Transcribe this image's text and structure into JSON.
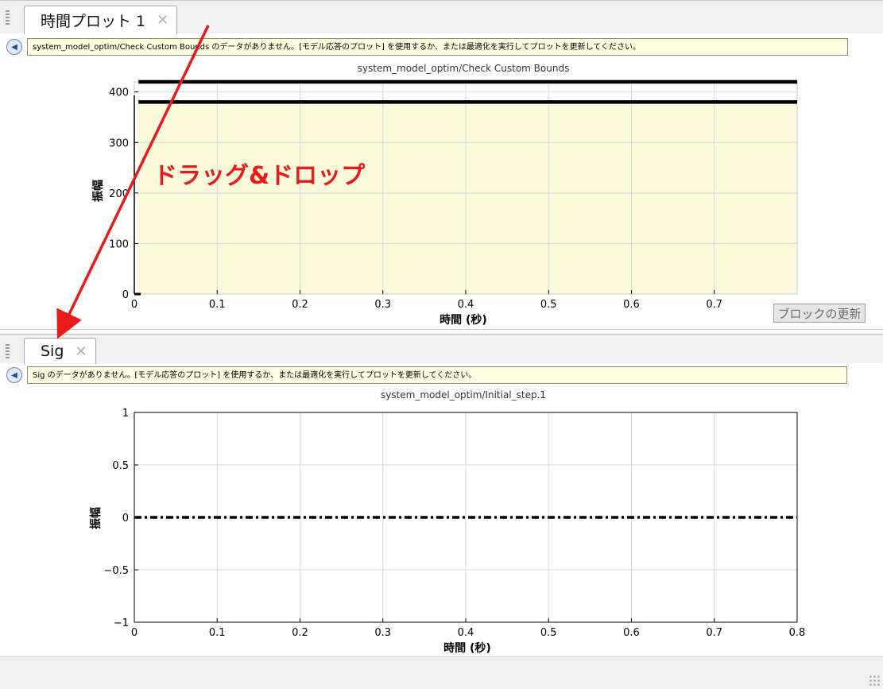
{
  "top_pane": {
    "tab": {
      "label": "時間プロット 1",
      "close": "✕"
    },
    "message": "system_model_optim/Check Custom Bounds のデータがありません。[モデル応答のプロット] を使用するか、または最適化を実行してプロットを更新してください。",
    "plot_title": "system_model_optim/Check Custom Bounds",
    "xlabel": "時間 (秒)",
    "ylabel": "振幅",
    "update_button": "ブロックの更新"
  },
  "bottom_pane": {
    "tab": {
      "label": "Sig",
      "close": "✕"
    },
    "message": "Sig のデータがありません。[モデル応答のプロット] を使用するか、または最適化を実行してプロットを更新してください。",
    "plot_title": "system_model_optim/Initial_step.1",
    "xlabel": "時間 (秒)",
    "ylabel": "振幅"
  },
  "annotation": {
    "text": "ドラッグ&ドロップ",
    "color": "#e81a1a"
  },
  "colors": {
    "bounds_fill": "#fbfbdb",
    "info_bg": "#ffffe1",
    "grid": "#d8d8d8"
  },
  "chart_data": [
    {
      "type": "line",
      "title": "system_model_optim/Check Custom Bounds",
      "xlabel": "時間 (秒)",
      "ylabel": "振幅",
      "xlim": [
        0,
        0.8
      ],
      "ylim": [
        0,
        420
      ],
      "x_ticks": [
        "0",
        "0.1",
        "0.2",
        "0.3",
        "0.4",
        "0.5",
        "0.6",
        "0.7"
      ],
      "y_ticks": [
        "0",
        "100",
        "200",
        "300",
        "400"
      ],
      "grid": true,
      "series": [
        {
          "values": [
            {
              "x": 0.005,
              "y": 420
            },
            {
              "x": 0.8,
              "y": 420
            }
          ]
        },
        {
          "values": [
            {
              "x": 0.005,
              "y": 380
            },
            {
              "x": 0.8,
              "y": 380
            }
          ]
        }
      ]
    },
    {
      "type": "line",
      "title": "system_model_optim/Initial_step.1",
      "xlabel": "時間 (秒)",
      "ylabel": "振幅",
      "xlim": [
        0,
        0.8
      ],
      "ylim": [
        -1,
        1
      ],
      "x_ticks": [
        "0",
        "0.1",
        "0.2",
        "0.3",
        "0.4",
        "0.5",
        "0.6",
        "0.7",
        "0.8"
      ],
      "y_ticks": [
        "−1",
        "−0.5",
        "0",
        "0.5",
        "1"
      ],
      "grid": true,
      "series": [
        {
          "style": "dash-dot",
          "values": [
            {
              "x": 0,
              "y": 0
            },
            {
              "x": 0.8,
              "y": 0
            }
          ]
        }
      ]
    }
  ]
}
